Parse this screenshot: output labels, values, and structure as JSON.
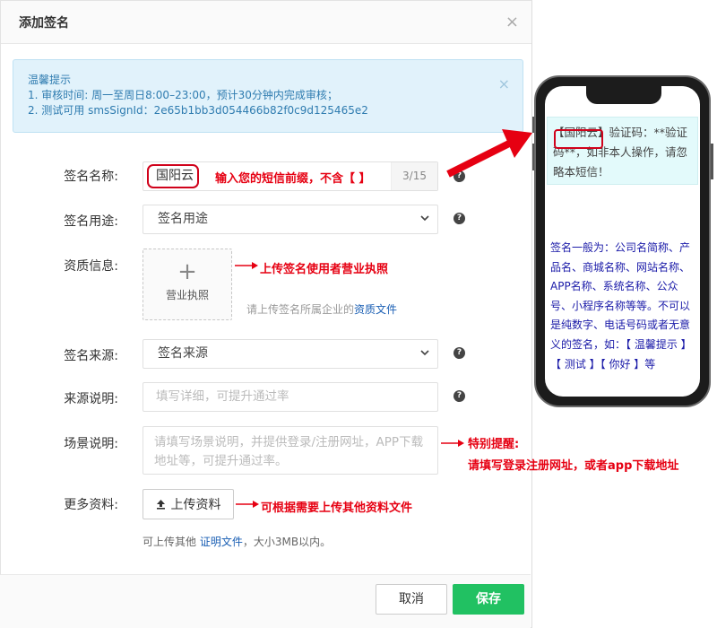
{
  "dialog": {
    "title": "添加签名",
    "close": "×"
  },
  "notice": {
    "title": "温馨提示",
    "line1": "1. 审核时间: 周一至周日8:00–23:00，预计30分钟内完成审核；",
    "line2": "2. 测试可用 smsSignId：2e65b1bb3d054466b82f0c9d125465e2",
    "close": "×"
  },
  "form": {
    "sign_name": {
      "label": "签名名称:",
      "value": "国阳云",
      "counter": "3/15"
    },
    "sign_usage": {
      "label": "签名用途:",
      "selected": "签名用途"
    },
    "qualification": {
      "label": "资质信息:",
      "upload_label": "营业执照",
      "hint_prefix": "请上传签名所属企业的",
      "hint_link": "资质文件"
    },
    "sign_source": {
      "label": "签名来源:",
      "selected": "签名来源"
    },
    "source_desc": {
      "label": "来源说明:",
      "placeholder": "填写详细，可提升通过率"
    },
    "scene_desc": {
      "label": "场景说明:",
      "placeholder": "请填写场景说明，并提供登录/注册网址，APP下载地址等，可提升通过率。"
    },
    "more_info": {
      "label": "更多资料:",
      "button": "上传资料",
      "hint_prefix": "可上传其他",
      "hint_link": "证明文件",
      "hint_suffix": "，大小3MB以内。"
    }
  },
  "footer": {
    "cancel": "取消",
    "save": "保存"
  },
  "annotations": {
    "sign_name": "输入您的短信前缀，不含【 】",
    "qualification": "上传签名使用者营业执照",
    "scene_title": "特别提醒:",
    "scene_body": "请填写登录注册网址，或者app下载地址",
    "more_info": "可根据需要上传其他资料文件"
  },
  "phone": {
    "sms_prefix": "【国阳云】",
    "sms_text": "验证码：**验证码**，如非本人操作，请忽略本短信！",
    "note": "签名一般为：公司名简称、产品名、商城名称、网站名称、APP名称、系统名称、公众号、小程序名称等等。不可以是纯数字、电话号码或者无意义的签名，如：【 温馨提示 】【 测试 】【 你好 】等"
  },
  "colors": {
    "accent_green": "#21c162",
    "annotation_red": "#e60012",
    "notice_bg": "#e1f2fb",
    "link_blue": "#1a5fb4"
  }
}
